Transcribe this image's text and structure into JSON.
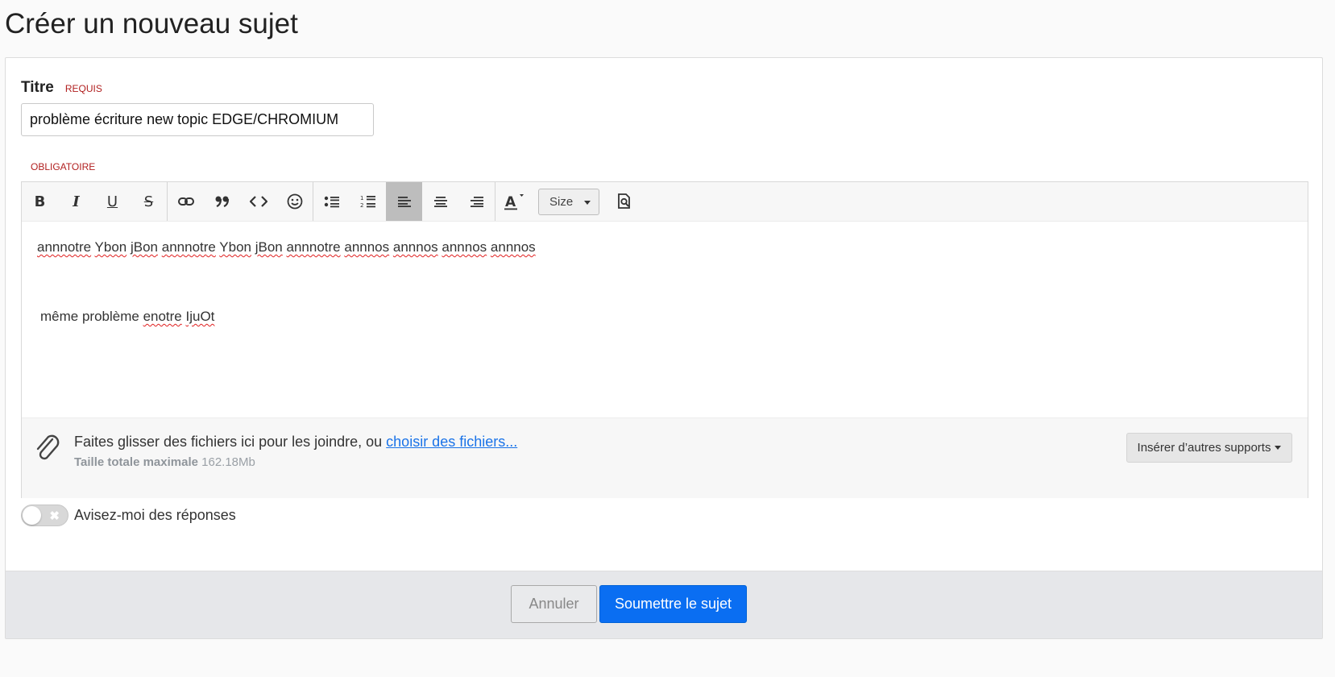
{
  "page": {
    "title": "Créer un nouveau sujet"
  },
  "form": {
    "title_label": "Titre",
    "title_required": "REQUIS",
    "title_value": "problème écriture new topic EDGE/CHROMIUM",
    "body_required": "OBLIGATOIRE"
  },
  "toolbar": {
    "buttons": [
      "bold",
      "italic",
      "underline",
      "strikethrough",
      "link",
      "quote",
      "code",
      "emoji",
      "bullet-list",
      "numbered-list",
      "align-left",
      "align-center",
      "align-right",
      "text-color",
      "size",
      "preview"
    ],
    "active": "align-left",
    "size_label": "Size"
  },
  "editor": {
    "line1_words": [
      "annnotre",
      "Ybon",
      "jBon",
      "annnotre",
      "Ybon",
      "jBon",
      "annnotre",
      "annnos",
      "annnos",
      "annnos",
      "annnos"
    ],
    "line2_plain": "même problème ",
    "line2_words": [
      "enotre",
      "IjuOt"
    ]
  },
  "attachments": {
    "drop_text": "Faites glisser des fichiers ici pour les joindre, ou ",
    "choose_link": "choisir des fichiers...",
    "max_label": "Taille totale maximale",
    "max_value": "162.18Mb",
    "insert_button": "Insérer d’autres supports"
  },
  "notify": {
    "label": "Avisez-moi des réponses",
    "enabled": false
  },
  "actions": {
    "cancel": "Annuler",
    "submit": "Soumettre le sujet"
  },
  "colors": {
    "primary": "#0a6ef2",
    "required": "#b11f1f",
    "link": "#1a73e8"
  }
}
